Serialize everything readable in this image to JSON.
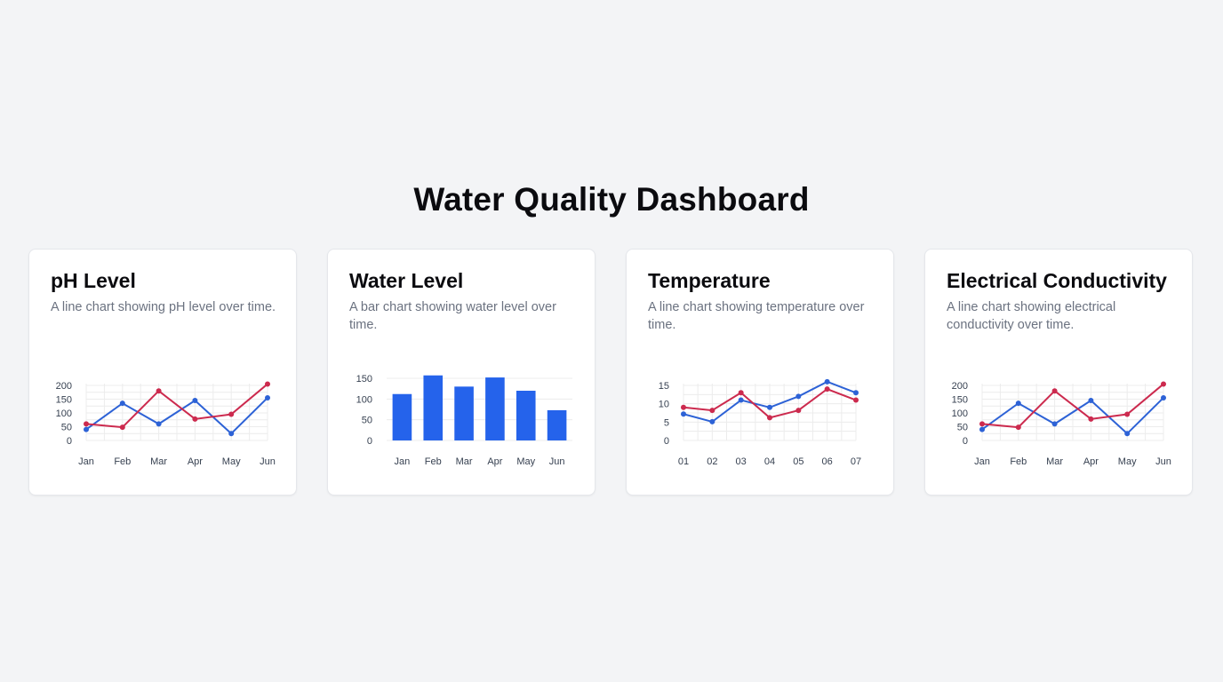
{
  "page": {
    "title": "Water Quality Dashboard"
  },
  "colors": {
    "blue": "#2d62d6",
    "red": "#cc2a4e",
    "bar": "#2563eb"
  },
  "cards": [
    {
      "title": "pH Level",
      "description": "A line chart showing pH level over time.",
      "chart_data": {
        "type": "line",
        "categories": [
          "Jan",
          "Feb",
          "Mar",
          "Apr",
          "May",
          "Jun"
        ],
        "y_ticks": [
          "0",
          "50",
          "100",
          "150",
          "200"
        ],
        "ylim": [
          0,
          200
        ],
        "grid": true,
        "series": [
          {
            "values": [
              40,
              135,
              60,
              145,
              25,
              155
            ],
            "color": "#2d62d6"
          },
          {
            "values": [
              60,
              48,
              180,
              78,
              95,
              205
            ],
            "color": "#cc2a4e"
          }
        ]
      }
    },
    {
      "title": "Water Level",
      "description": "A bar chart showing water level over time.",
      "chart_data": {
        "type": "bar",
        "categories": [
          "Jan",
          "Feb",
          "Mar",
          "Apr",
          "May",
          "Jun"
        ],
        "y_ticks": [
          "0",
          "50",
          "100",
          "150"
        ],
        "ylim": [
          0,
          150
        ],
        "grid": true,
        "series": [
          {
            "values": [
              112,
              157,
              130,
              152,
              120,
              73
            ],
            "color": "#2563eb"
          }
        ]
      }
    },
    {
      "title": "Temperature",
      "description": "A line chart showing temperature over time.",
      "chart_data": {
        "type": "line",
        "categories": [
          "01",
          "02",
          "03",
          "04",
          "05",
          "06",
          "07"
        ],
        "y_ticks": [
          "0",
          "5",
          "10",
          "15"
        ],
        "ylim": [
          0,
          15
        ],
        "grid": true,
        "series": [
          {
            "values": [
              7.2,
              5.1,
              11,
              9,
              12,
              16,
              13
            ],
            "color": "#2d62d6"
          },
          {
            "values": [
              9,
              8.2,
              13,
              6.2,
              8.2,
              14,
              11
            ],
            "color": "#cc2a4e"
          }
        ]
      }
    },
    {
      "title": "Electrical Conductivity",
      "description": "A line chart showing electrical conductivity over time.",
      "chart_data": {
        "type": "line",
        "categories": [
          "Jan",
          "Feb",
          "Mar",
          "Apr",
          "May",
          "Jun"
        ],
        "y_ticks": [
          "0",
          "50",
          "100",
          "150",
          "200"
        ],
        "ylim": [
          0,
          200
        ],
        "grid": true,
        "series": [
          {
            "values": [
              40,
              135,
              60,
              145,
              25,
              155
            ],
            "color": "#2d62d6"
          },
          {
            "values": [
              60,
              48,
              180,
              78,
              95,
              205
            ],
            "color": "#cc2a4e"
          }
        ]
      }
    }
  ]
}
